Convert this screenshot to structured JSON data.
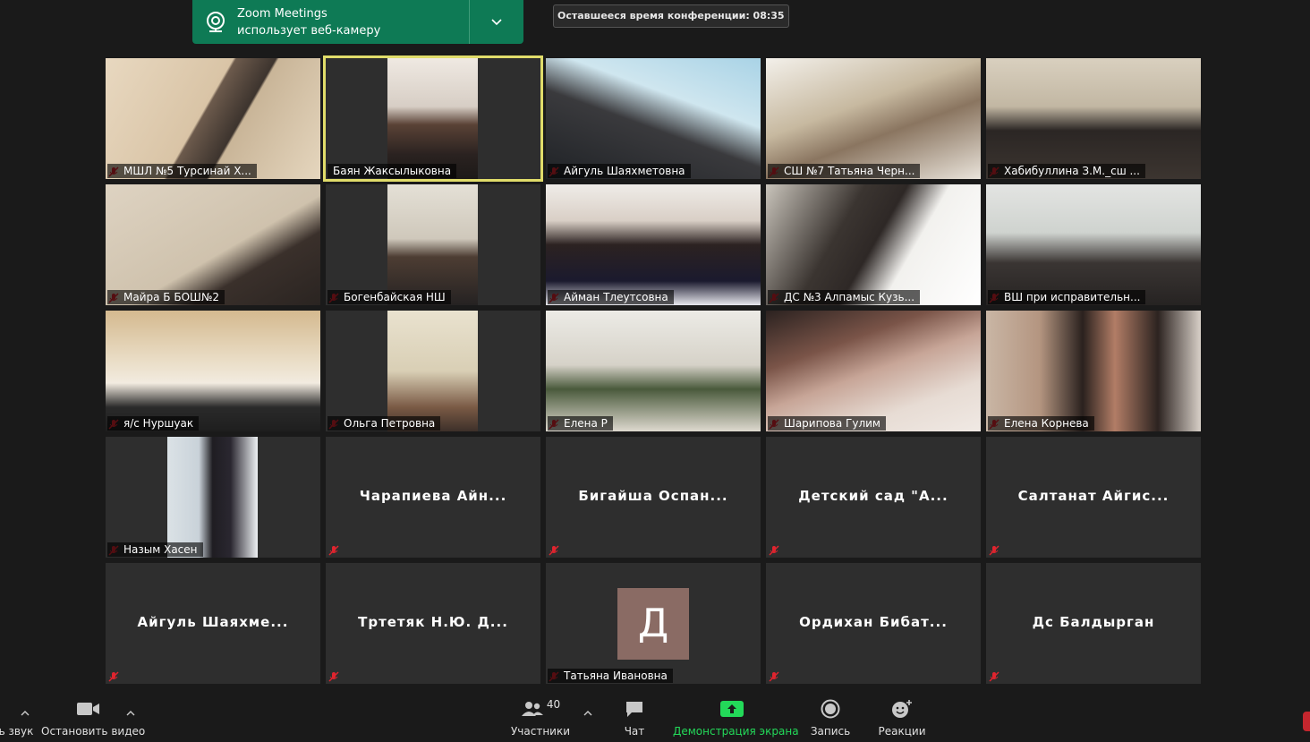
{
  "notification": {
    "line1": "Zoom Meetings",
    "line2": "использует веб-камеру"
  },
  "timer": {
    "text": "Оставшееся время конференции: 08:35"
  },
  "participants": [
    {
      "name": "МШЛ №5 Турсинай Х...",
      "video": true
    },
    {
      "name": "Баян Жаксылыковна",
      "video": true,
      "active": true
    },
    {
      "name": "Айгуль Шаяхметовна",
      "video": true
    },
    {
      "name": "СШ №7 Татьяна Черн...",
      "video": true
    },
    {
      "name": "Хабибуллина З.М._сш ...",
      "video": true
    },
    {
      "name": "Майра Б БОШ№2",
      "video": true
    },
    {
      "name": "Богенбайская НШ",
      "video": true
    },
    {
      "name": "Айман Тлеутсовна",
      "video": true
    },
    {
      "name": "ДС №3 Алпамыс Кузь...",
      "video": true
    },
    {
      "name": "ВШ при исправительн...",
      "video": true
    },
    {
      "name": "я/с Нуршуак",
      "video": true
    },
    {
      "name": "Ольга Петровна",
      "video": true
    },
    {
      "name": "Елена Р",
      "video": true
    },
    {
      "name": "Шарипова Гулим",
      "video": true
    },
    {
      "name": "Елена Корнева",
      "video": true
    },
    {
      "name": "Назым Хасен",
      "video": true
    },
    {
      "name": "Чарапиева Айн...",
      "video": false
    },
    {
      "name": "Бигайша Оспан...",
      "video": false
    },
    {
      "name": "Детский сад \"А...",
      "video": false
    },
    {
      "name": "Салтанат Айгис...",
      "video": false
    },
    {
      "name": "Айгуль Шаяхме...",
      "video": false
    },
    {
      "name": "Тртетяк Н.Ю. Д...",
      "video": false
    },
    {
      "name": "Татьяна Ивановна",
      "video": false,
      "avatar": "Д"
    },
    {
      "name": "Ордихан Бибат...",
      "video": false
    },
    {
      "name": "Дс Балдырган",
      "video": false
    }
  ],
  "toolbar": {
    "audio_label": "ь звук",
    "video_label": "Остановить видео",
    "participants_label": "Участники",
    "participants_count": "40",
    "chat_label": "Чат",
    "share_label": "Демонстрация экрана",
    "record_label": "Запись",
    "reactions_label": "Реакции"
  },
  "colors": {
    "share_green": "#23d959",
    "active_outline": "#e0dc6a",
    "mute_red": "#e0242e",
    "notify_bg": "#0e7a55"
  }
}
